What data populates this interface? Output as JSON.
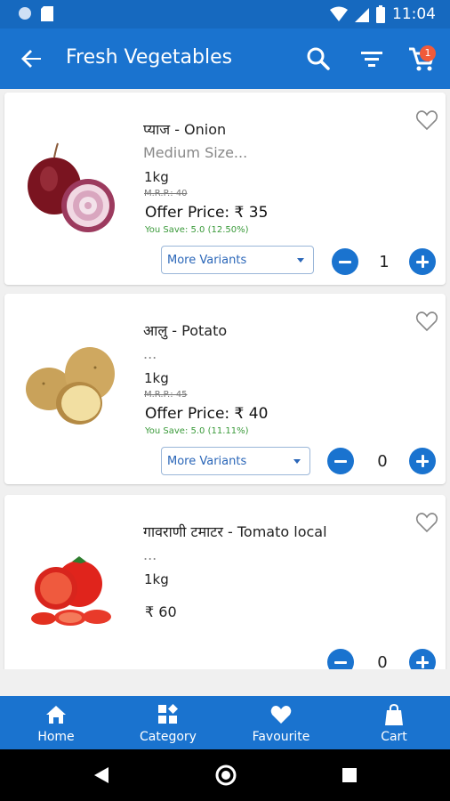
{
  "status_bar": {
    "time": "11:04"
  },
  "app_bar": {
    "title": "Fresh Vegetables",
    "cart_count": "1"
  },
  "products": [
    {
      "name": "प्याज - Onion",
      "desc": "Medium Size...",
      "unit": "1kg",
      "mrp": "M.R.P.: 40",
      "offer": "Offer Price: ₹ 35",
      "save": "You Save: 5.0 (12.50%)",
      "variants": "More Variants",
      "qty": "1"
    },
    {
      "name": "आलु - Potato",
      "desc": "...",
      "unit": "1kg",
      "mrp": "M.R.P.: 45",
      "offer": "Offer Price: ₹ 40",
      "save": "You Save: 5.0 (11.11%)",
      "variants": "More Variants",
      "qty": "0"
    },
    {
      "name": "गावराणी टमाटर - Tomato local",
      "desc": "...",
      "unit": "1kg",
      "price": "₹ 60",
      "qty": "0"
    }
  ],
  "bottom_nav": [
    {
      "label": "Home",
      "icon": "home-icon"
    },
    {
      "label": "Category",
      "icon": "category-icon"
    },
    {
      "label": "Favourite",
      "icon": "heart-icon"
    },
    {
      "label": "Cart",
      "icon": "bag-icon"
    }
  ],
  "colors": {
    "primary": "#1a73cf",
    "status_bar": "#1669bf",
    "save_green": "#3a9a3a",
    "badge": "#f05a3a"
  }
}
